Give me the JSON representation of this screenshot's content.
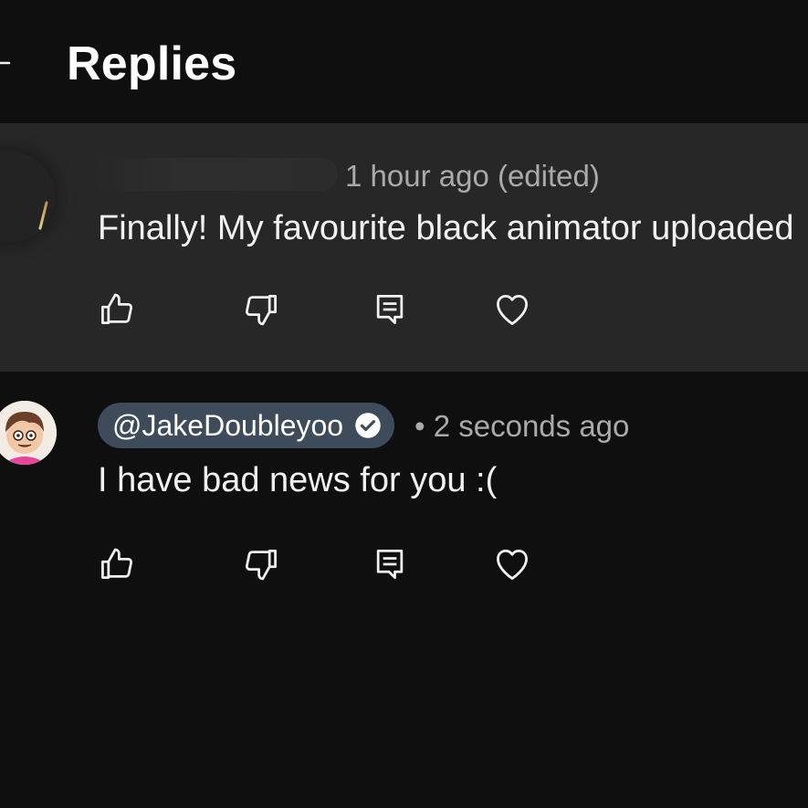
{
  "header": {
    "title": "Replies",
    "back_icon": "arrow-left-icon"
  },
  "parent_comment": {
    "timestamp": "1 hour ago (edited)",
    "text": "Finally! My favourite black animator uploaded",
    "actions": [
      "thumb-up-icon",
      "thumb-down-icon",
      "reply-icon",
      "heart-icon"
    ]
  },
  "reply": {
    "author": "@JakeDoubleyoo",
    "verified": true,
    "timestamp": "• 2 seconds ago",
    "text": "I have bad news for you :(",
    "actions": [
      "thumb-up-icon",
      "thumb-down-icon",
      "reply-icon",
      "heart-icon"
    ]
  },
  "colors": {
    "background": "#0f0f0f",
    "highlight_background": "#272727",
    "author_chip": "#3e4b5b",
    "primary_text": "#f1f1f1",
    "secondary_text": "#aaaaaa"
  }
}
